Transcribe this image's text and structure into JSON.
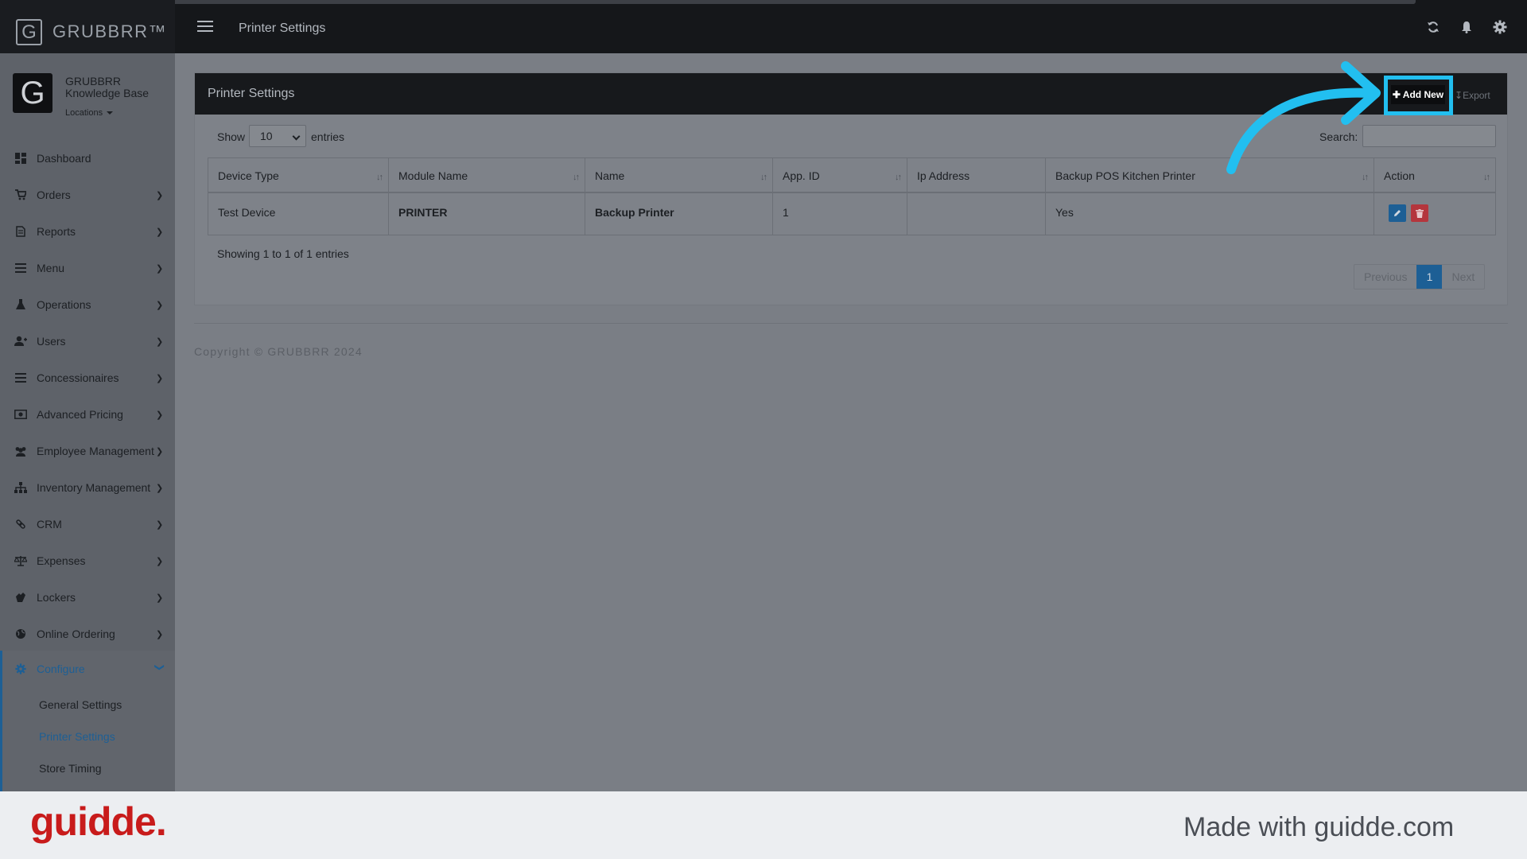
{
  "app": {
    "brand": "GRUBBRR™",
    "brand_logo": "G",
    "page_heading": "Printer Settings"
  },
  "top_icons": [
    "refresh-icon",
    "bell-icon",
    "gear-icon"
  ],
  "profile": {
    "logo": "G",
    "name_line1": "GRUBBRR",
    "name_line2": "Knowledge Base",
    "locations_label": "Locations"
  },
  "sidebar": {
    "items": [
      {
        "label": "Dashboard",
        "icon": "dashboard-icon"
      },
      {
        "label": "Orders",
        "icon": "cart-icon"
      },
      {
        "label": "Reports",
        "icon": "report-icon"
      },
      {
        "label": "Menu",
        "icon": "list-icon"
      },
      {
        "label": "Operations",
        "icon": "flask-icon"
      },
      {
        "label": "Users",
        "icon": "user-add-icon"
      },
      {
        "label": "Concessionaires",
        "icon": "list-icon"
      },
      {
        "label": "Advanced Pricing",
        "icon": "money-icon"
      },
      {
        "label": "Employee Management",
        "icon": "users-icon"
      },
      {
        "label": "Inventory Management",
        "icon": "sitemap-icon"
      },
      {
        "label": "CRM",
        "icon": "link-icon"
      },
      {
        "label": "Expenses",
        "icon": "scale-icon"
      },
      {
        "label": "Lockers",
        "icon": "locker-icon"
      },
      {
        "label": "Online Ordering",
        "icon": "globe-icon"
      }
    ],
    "configure": {
      "label": "Configure",
      "sub_items": [
        "General Settings",
        "Printer Settings",
        "Store Timing"
      ],
      "active": "Printer Settings"
    }
  },
  "card": {
    "title": "Printer Settings",
    "add_new_label": "Add New",
    "export_label": "Export",
    "show_label": "Show",
    "show_value": "10",
    "entries_label": "entries",
    "search_label": "Search:",
    "columns": [
      "Device Type",
      "Module Name",
      "Name",
      "App. ID",
      "Ip Address",
      "Backup POS Kitchen Printer",
      "Action"
    ],
    "rows": [
      {
        "device_type": "Test Device",
        "module_name": "PRINTER",
        "name": "Backup Printer",
        "app_id": "1",
        "ip_address": "",
        "backup_pos": "Yes"
      }
    ],
    "showing_text": "Showing 1 to 1 of 1 entries",
    "pagination": {
      "previous": "Previous",
      "current": "1",
      "next": "Next"
    }
  },
  "copyright": "Copyright © GRUBBRR 2024",
  "footer": {
    "logo": "guidde.",
    "made_with": "Made with guidde.com"
  },
  "colors": {
    "accent_blue": "#1d5f95",
    "highlight_cyan": "#22bff0",
    "delete_red": "#b4363d",
    "guidde_red": "#c81b1b"
  }
}
